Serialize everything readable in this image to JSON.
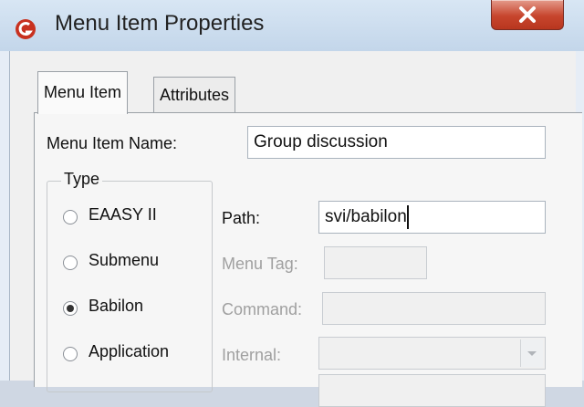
{
  "window": {
    "title": "Menu Item Properties",
    "close_label": "x"
  },
  "tabs": [
    {
      "label": "Menu Item",
      "active": true
    },
    {
      "label": "Attributes",
      "active": false
    }
  ],
  "form": {
    "menu_item_name_label": "Menu Item Name:",
    "menu_item_name_value": "Group discussion",
    "type_group_label": "Type",
    "type_options": [
      {
        "label": "EAASY II",
        "selected": false
      },
      {
        "label": "Submenu",
        "selected": false
      },
      {
        "label": "Babilon",
        "selected": true
      },
      {
        "label": "Application",
        "selected": false
      }
    ],
    "path_label": "Path:",
    "path_value": "svi/babilon",
    "menu_tag_label": "Menu Tag:",
    "menu_tag_value": "",
    "command_label": "Command:",
    "command_value": "",
    "internal_label": "Internal:",
    "internal_value": ""
  },
  "colors": {
    "titlebar": "#c9dbee",
    "close_button": "#c7452d",
    "app_icon": "#c8311f"
  },
  "icons": {
    "app": "app-logo-icon",
    "close": "close-icon",
    "combo": "chevron-down-icon"
  }
}
